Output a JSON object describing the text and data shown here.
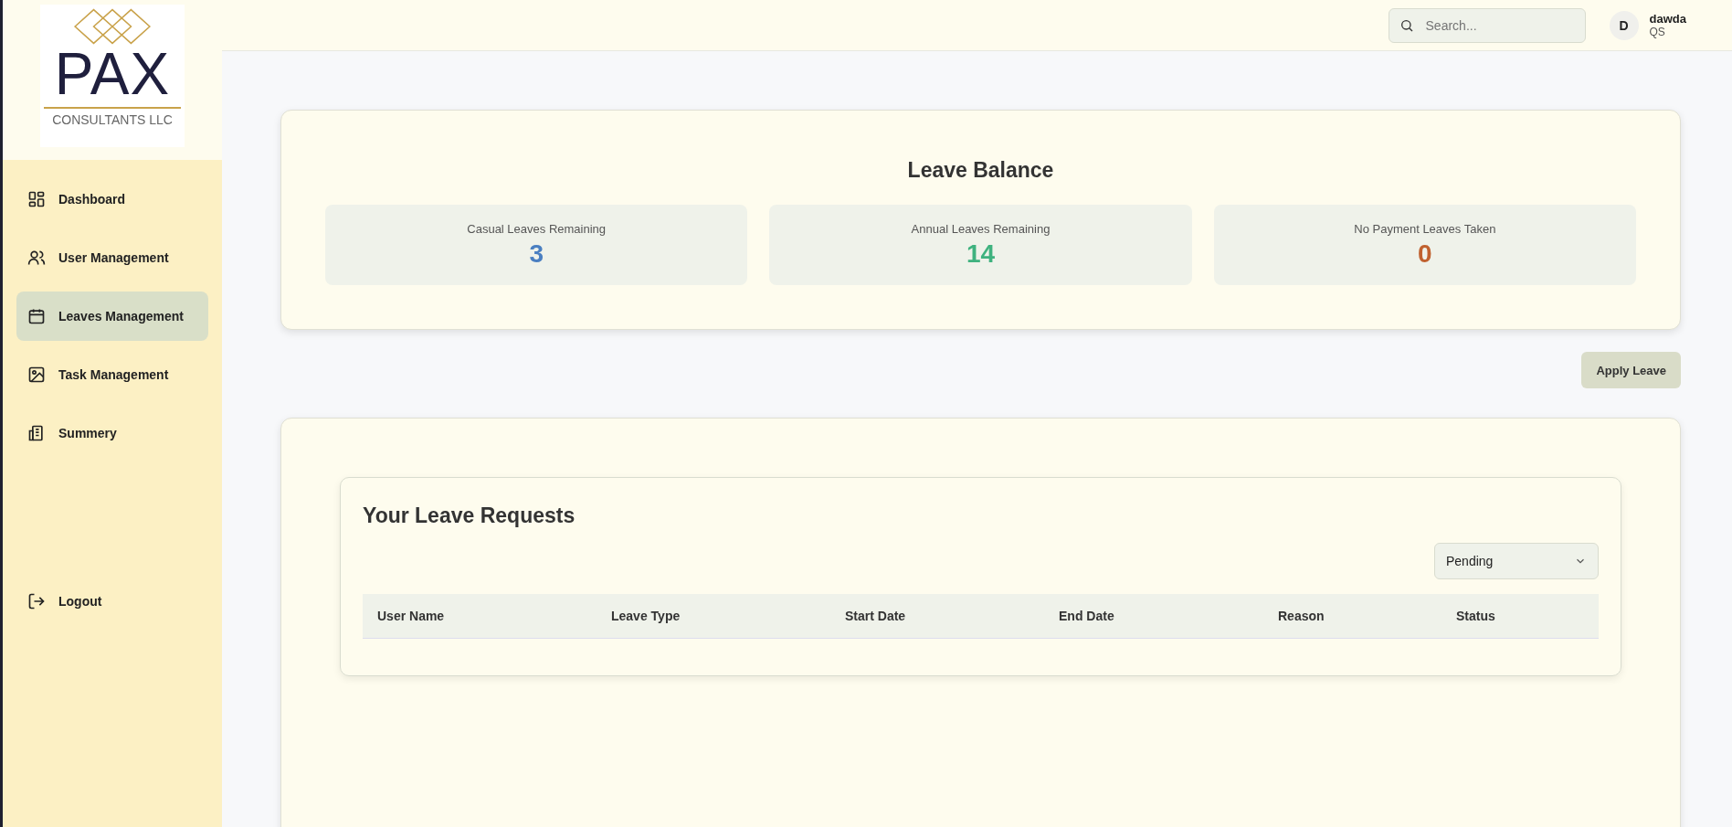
{
  "logo": {
    "name": "PAX",
    "subtitle": "CONSULTANTS LLC"
  },
  "sidebar": {
    "items": [
      {
        "label": "Dashboard",
        "selected": false
      },
      {
        "label": "User Management",
        "selected": false
      },
      {
        "label": "Leaves Management",
        "selected": true
      },
      {
        "label": "Task Management",
        "selected": false
      },
      {
        "label": "Summery",
        "selected": false
      }
    ],
    "logout": "Logout"
  },
  "header": {
    "search": {
      "placeholder": "Search..."
    },
    "user": {
      "initial": "D",
      "name": "dawda",
      "role": "QS"
    }
  },
  "leave_balance": {
    "title": "Leave Balance",
    "stats": [
      {
        "label": "Casual Leaves Remaining",
        "value": "3",
        "color": "#4a7fc1"
      },
      {
        "label": "Annual Leaves Remaining",
        "value": "14",
        "color": "#3fb27f"
      },
      {
        "label": "No Payment Leaves Taken",
        "value": "0",
        "color": "#c0612f"
      }
    ]
  },
  "apply_button": "Apply Leave",
  "leave_requests": {
    "title": "Your Leave Requests",
    "filter": "Pending",
    "table": {
      "columns": [
        "User Name",
        "Leave Type",
        "Start Date",
        "End Date",
        "Reason",
        "Status"
      ]
    }
  }
}
